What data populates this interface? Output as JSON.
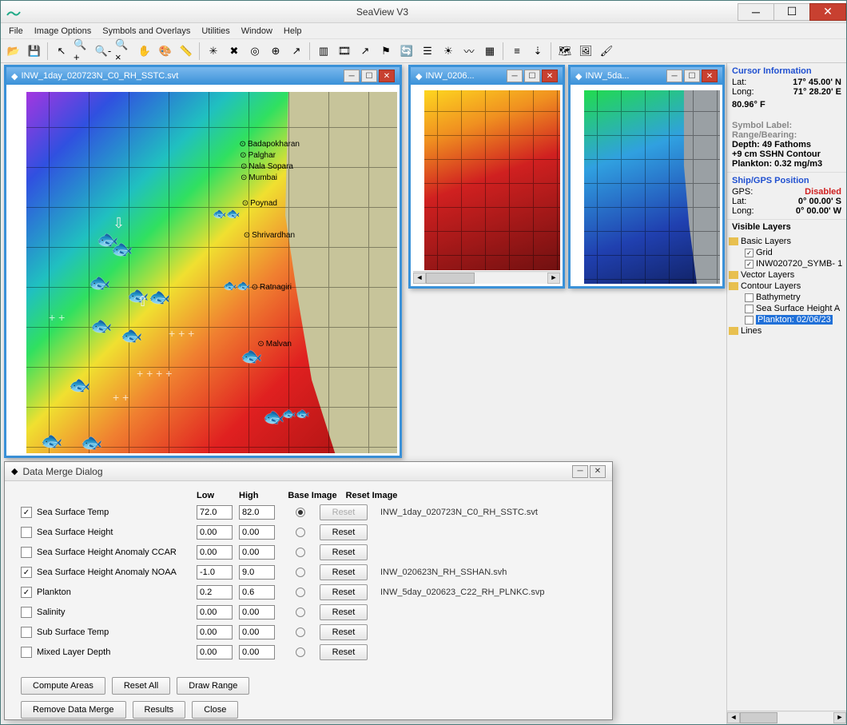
{
  "app": {
    "title": "SeaView V3"
  },
  "menu": [
    "File",
    "Image Options",
    "Symbols and Overlays",
    "Utilities",
    "Window",
    "Help"
  ],
  "toolbar_icons": [
    "open",
    "save",
    "|",
    "pointer",
    "zoom-in",
    "zoom-out",
    "zoom-reset",
    "pan",
    "palette",
    "ruler",
    "|",
    "target1",
    "target2",
    "target3",
    "target4",
    "path",
    "|",
    "stack",
    "film",
    "arrow-up",
    "flag",
    "globe-refresh",
    "layers",
    "sun",
    "wave",
    "grid",
    "|",
    "bars",
    "anchor-down",
    "|",
    "chart",
    "picture",
    "paint-layer"
  ],
  "subwindows": {
    "main": {
      "title": "INW_1day_020723N_C0_RH_SSTC.svt"
    },
    "b": {
      "title": "INW_0206..."
    },
    "c": {
      "title": "INW_5da..."
    }
  },
  "cities": [
    "Badapokharan",
    "Palghar",
    "Nala Sopara",
    "Mumbai",
    "Poynad",
    "Shrivardhan",
    "Ratnagiri",
    "Malvan"
  ],
  "cursor": {
    "header": "Cursor Information",
    "lat_label": "Lat:",
    "lat": "17° 45.00' N",
    "lon_label": "Long:",
    "lon": "71° 28.20' E",
    "temp": "80.96° F",
    "sym_label": "Symbol Label:",
    "rb_label": "Range/Bearing:",
    "depth": "Depth: 49 Fathoms",
    "sshn": "+9 cm SSHN Contour",
    "plankton": "Plankton: 0.32 mg/m3"
  },
  "ship": {
    "header": "Ship/GPS Position",
    "gps_label": "GPS:",
    "gps": "Disabled",
    "lat_label": "Lat:",
    "lat": "0° 00.00' S",
    "lon_label": "Long:",
    "lon": "0° 00.00' W"
  },
  "layers": {
    "header": "Visible Layers",
    "basic": "Basic Layers",
    "grid": "Grid",
    "symb": "INW020720_SYMB- 1",
    "vector": "Vector Layers",
    "contour": "Contour Layers",
    "bathy": "Bathymetry",
    "ssh": "Sea Surface Height A",
    "plk": "Plankton: 02/06/23",
    "lines": "Lines"
  },
  "dialog": {
    "title": "Data Merge Dialog",
    "cols": {
      "low": "Low",
      "high": "High",
      "base": "Base Image",
      "reset": "Reset Image"
    },
    "rows": [
      {
        "checked": true,
        "label": "Sea Surface Temp",
        "low": "72.0",
        "high": "82.0",
        "base": true,
        "reset_disabled": true,
        "file": "INW_1day_020723N_C0_RH_SSTC.svt"
      },
      {
        "checked": false,
        "label": "Sea Surface Height",
        "low": "0.00",
        "high": "0.00",
        "base": false,
        "file": ""
      },
      {
        "checked": false,
        "label": "Sea Surface Height Anomaly CCAR",
        "low": "0.00",
        "high": "0.00",
        "base": false,
        "file": ""
      },
      {
        "checked": true,
        "label": "Sea Surface Height Anomaly NOAA",
        "low": "-1.0",
        "high": "9.0",
        "base": false,
        "file": "INW_020623N_RH_SSHAN.svh"
      },
      {
        "checked": true,
        "label": "Plankton",
        "low": "0.2",
        "high": "0.6",
        "base": false,
        "file": "INW_5day_020623_C22_RH_PLNKC.svp"
      },
      {
        "checked": false,
        "label": "Salinity",
        "low": "0.00",
        "high": "0.00",
        "base": false,
        "file": ""
      },
      {
        "checked": false,
        "label": "Sub Surface Temp",
        "low": "0.00",
        "high": "0.00",
        "base": false,
        "file": ""
      },
      {
        "checked": false,
        "label": "Mixed Layer Depth",
        "low": "0.00",
        "high": "0.00",
        "base": false,
        "file": ""
      }
    ],
    "btn_reset": "Reset",
    "btns1": [
      "Compute Areas",
      "Reset All",
      "Draw Range"
    ],
    "btns2": [
      "Remove Data Merge",
      "Results",
      "Close"
    ]
  }
}
